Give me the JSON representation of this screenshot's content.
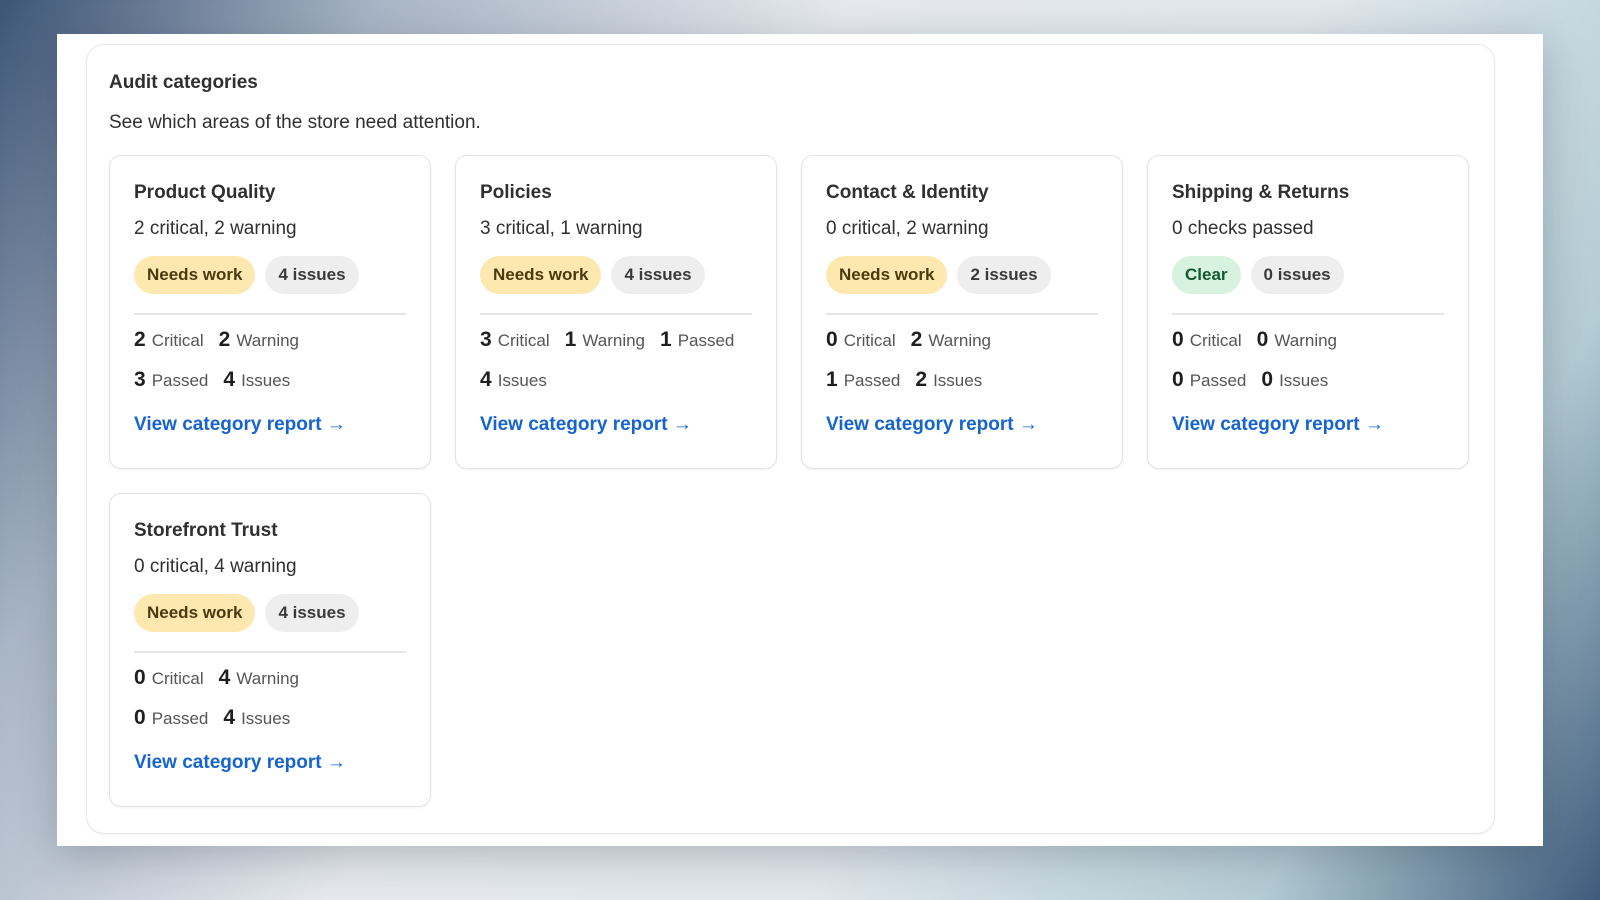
{
  "panel": {
    "title": "Audit categories",
    "subtitle": "See which areas of the store need attention."
  },
  "colors": {
    "needs_work_bg": "#fde8b0",
    "clear_bg": "#d7f2de",
    "link": "#1664d0"
  },
  "categories": [
    {
      "title": "Product Quality",
      "summary": "2 critical, 2 warning",
      "status": "Needs work",
      "issues_badge": "4 issues",
      "stats": [
        {
          "value": "2",
          "label": "Critical"
        },
        {
          "value": "2",
          "label": "Warning"
        },
        {
          "value": "3",
          "label": "Passed"
        },
        {
          "value": "4",
          "label": "Issues"
        }
      ],
      "link": "View category report →"
    },
    {
      "title": "Policies",
      "summary": "3 critical, 1 warning",
      "status": "Needs work",
      "issues_badge": "4 issues",
      "stats": [
        {
          "value": "3",
          "label": "Critical"
        },
        {
          "value": "1",
          "label": "Warning"
        },
        {
          "value": "1",
          "label": "Passed"
        },
        {
          "value": "4",
          "label": "Issues"
        }
      ],
      "link": "View category report →"
    },
    {
      "title": "Contact & Identity",
      "summary": "0 critical, 2 warning",
      "status": "Needs work",
      "issues_badge": "2 issues",
      "stats": [
        {
          "value": "0",
          "label": "Critical"
        },
        {
          "value": "2",
          "label": "Warning"
        },
        {
          "value": "1",
          "label": "Passed"
        },
        {
          "value": "2",
          "label": "Issues"
        }
      ],
      "link": "View category report →"
    },
    {
      "title": "Shipping & Returns",
      "summary": "0 checks passed",
      "status": "Clear",
      "issues_badge": "0 issues",
      "stats": [
        {
          "value": "0",
          "label": "Critical"
        },
        {
          "value": "0",
          "label": "Warning"
        },
        {
          "value": "0",
          "label": "Passed"
        },
        {
          "value": "0",
          "label": "Issues"
        }
      ],
      "link": "View category report →"
    },
    {
      "title": "Storefront Trust",
      "summary": "0 critical, 4 warning",
      "status": "Needs work",
      "issues_badge": "4 issues",
      "stats": [
        {
          "value": "0",
          "label": "Critical"
        },
        {
          "value": "4",
          "label": "Warning"
        },
        {
          "value": "0",
          "label": "Passed"
        },
        {
          "value": "4",
          "label": "Issues"
        }
      ],
      "link": "View category report →"
    }
  ]
}
